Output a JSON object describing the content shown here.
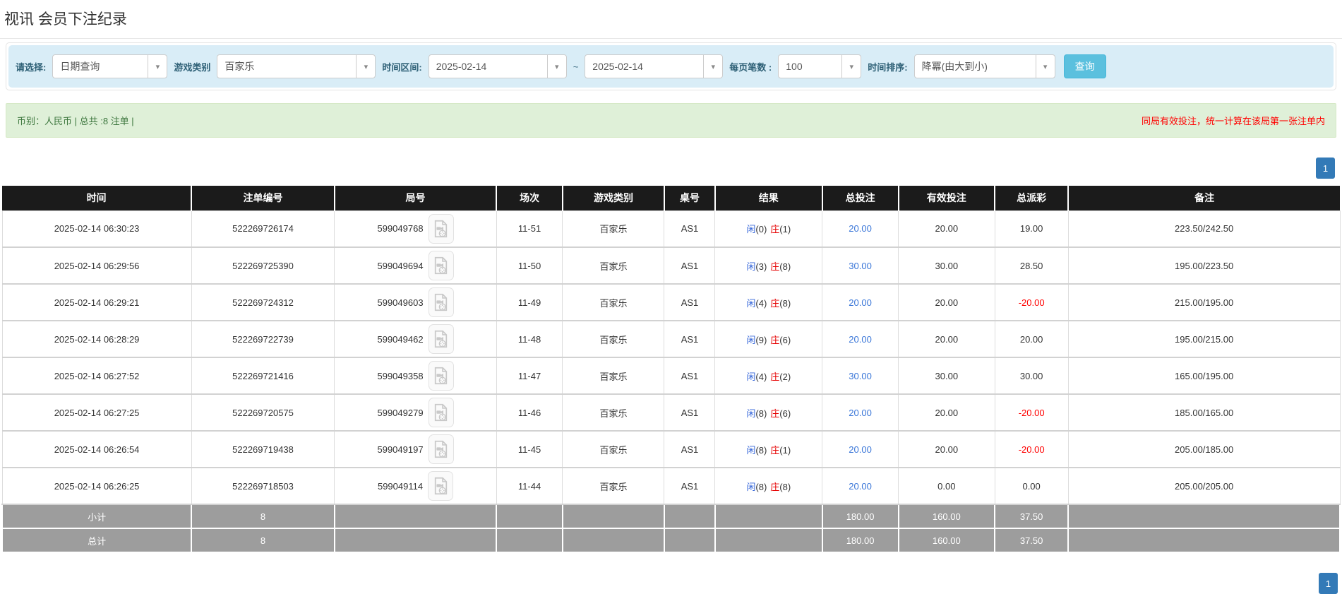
{
  "page": {
    "title": "视讯 会员下注纪录"
  },
  "filters": {
    "query_type": {
      "label": "请选择:",
      "value": "日期查询"
    },
    "game_type": {
      "label": "游戏类别",
      "value": "百家乐"
    },
    "date_range": {
      "label": "时间区间:",
      "from": "2025-02-14",
      "separator": "~",
      "to": "2025-02-14"
    },
    "page_size": {
      "label": "每页笔数 :",
      "value": "100"
    },
    "time_sort": {
      "label": "时间排序:",
      "value": "降冪(由大到小)"
    },
    "search_label": "查询"
  },
  "summary": {
    "left": "币别：人民币 | 总共 :8 注单 |",
    "right": "同局有效投注，统一计算在该局第一张注单内"
  },
  "pagination": {
    "current": "1"
  },
  "icons": {
    "chevron_down": "▾",
    "video_replay": "video-file"
  },
  "colors": {
    "header_bg": "#1b1b1b",
    "summary_row_bg": "#9d9d9d",
    "filter_bg": "#d9edf7",
    "alert_bg": "#dff0d8",
    "alert_text": "#3c763d",
    "warning_text": "#ff0000",
    "link_blue": "#3a76d8",
    "player_blue": "#3465d9",
    "banker_red": "#e60000",
    "search_button": "#5bc0de",
    "pagination_blue": "#337ab7"
  },
  "table": {
    "columns": [
      "时间",
      "注单编号",
      "局号",
      "场次",
      "游戏类别",
      "桌号",
      "结果",
      "总投注",
      "有效投注",
      "总派彩",
      "备注"
    ],
    "rows": [
      {
        "time": "2025-02-14 06:30:23",
        "bet_id": "522269726174",
        "round_id": "599049768",
        "session": "11-51",
        "game": "百家乐",
        "table_no": "AS1",
        "result_player_label": "闲",
        "result_player_score": "(0)",
        "result_banker_label": "庄",
        "result_banker_score": "(1)",
        "total_bet": "20.00",
        "valid_bet": "20.00",
        "payout": "19.00",
        "payout_negative": false,
        "remark": "223.50/242.50"
      },
      {
        "time": "2025-02-14 06:29:56",
        "bet_id": "522269725390",
        "round_id": "599049694",
        "session": "11-50",
        "game": "百家乐",
        "table_no": "AS1",
        "result_player_label": "闲",
        "result_player_score": "(3)",
        "result_banker_label": "庄",
        "result_banker_score": "(8)",
        "total_bet": "30.00",
        "valid_bet": "30.00",
        "payout": "28.50",
        "payout_negative": false,
        "remark": "195.00/223.50"
      },
      {
        "time": "2025-02-14 06:29:21",
        "bet_id": "522269724312",
        "round_id": "599049603",
        "session": "11-49",
        "game": "百家乐",
        "table_no": "AS1",
        "result_player_label": "闲",
        "result_player_score": "(4)",
        "result_banker_label": "庄",
        "result_banker_score": "(8)",
        "total_bet": "20.00",
        "valid_bet": "20.00",
        "payout": "-20.00",
        "payout_negative": true,
        "remark": "215.00/195.00"
      },
      {
        "time": "2025-02-14 06:28:29",
        "bet_id": "522269722739",
        "round_id": "599049462",
        "session": "11-48",
        "game": "百家乐",
        "table_no": "AS1",
        "result_player_label": "闲",
        "result_player_score": "(9)",
        "result_banker_label": "庄",
        "result_banker_score": "(6)",
        "total_bet": "20.00",
        "valid_bet": "20.00",
        "payout": "20.00",
        "payout_negative": false,
        "remark": "195.00/215.00"
      },
      {
        "time": "2025-02-14 06:27:52",
        "bet_id": "522269721416",
        "round_id": "599049358",
        "session": "11-47",
        "game": "百家乐",
        "table_no": "AS1",
        "result_player_label": "闲",
        "result_player_score": "(4)",
        "result_banker_label": "庄",
        "result_banker_score": "(2)",
        "total_bet": "30.00",
        "valid_bet": "30.00",
        "payout": "30.00",
        "payout_negative": false,
        "remark": "165.00/195.00"
      },
      {
        "time": "2025-02-14 06:27:25",
        "bet_id": "522269720575",
        "round_id": "599049279",
        "session": "11-46",
        "game": "百家乐",
        "table_no": "AS1",
        "result_player_label": "闲",
        "result_player_score": "(8)",
        "result_banker_label": "庄",
        "result_banker_score": "(6)",
        "total_bet": "20.00",
        "valid_bet": "20.00",
        "payout": "-20.00",
        "payout_negative": true,
        "remark": "185.00/165.00"
      },
      {
        "time": "2025-02-14 06:26:54",
        "bet_id": "522269719438",
        "round_id": "599049197",
        "session": "11-45",
        "game": "百家乐",
        "table_no": "AS1",
        "result_player_label": "闲",
        "result_player_score": "(8)",
        "result_banker_label": "庄",
        "result_banker_score": "(1)",
        "total_bet": "20.00",
        "valid_bet": "20.00",
        "payout": "-20.00",
        "payout_negative": true,
        "remark": "205.00/185.00"
      },
      {
        "time": "2025-02-14 06:26:25",
        "bet_id": "522269718503",
        "round_id": "599049114",
        "session": "11-44",
        "game": "百家乐",
        "table_no": "AS1",
        "result_player_label": "闲",
        "result_player_score": "(8)",
        "result_banker_label": "庄",
        "result_banker_score": "(8)",
        "total_bet": "20.00",
        "valid_bet": "0.00",
        "payout": "0.00",
        "payout_negative": false,
        "remark": "205.00/205.00"
      }
    ],
    "summary_rows": [
      {
        "label": "小计",
        "count": "8",
        "total_bet": "180.00",
        "valid_bet": "160.00",
        "payout": "37.50"
      },
      {
        "label": "总计",
        "count": "8",
        "total_bet": "180.00",
        "valid_bet": "160.00",
        "payout": "37.50"
      }
    ]
  }
}
